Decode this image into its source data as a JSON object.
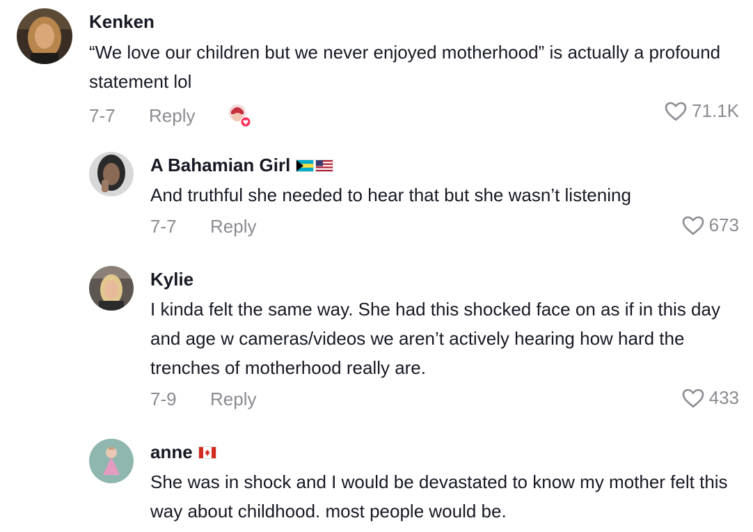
{
  "comments": [
    {
      "username": "Kenken",
      "text": "“We love our children but we never enjoyed motherhood” is actually a profound statement lol",
      "date": "7-7",
      "reply_label": "Reply",
      "likes": "71.1K",
      "creator_liked": true
    },
    {
      "username": "A Bahamian Girl",
      "flags": [
        "bahamas-flag",
        "usa-flag"
      ],
      "text": "And truthful she needed to hear that but she wasn’t listening",
      "date": "7-7",
      "reply_label": "Reply",
      "likes": "673"
    },
    {
      "username": "Kylie",
      "text": "I kinda felt the same way. She had this shocked face on as if in this day and age w cameras/videos we aren’t actively hearing how hard the trenches of motherhood really are.",
      "date": "7-9",
      "reply_label": "Reply",
      "likes": "433"
    },
    {
      "username": "anne",
      "flags": [
        "canada-flag"
      ],
      "text": "She was in shock and I would be devastated to know my mother felt this way about childhood. most people would be."
    }
  ],
  "colors": {
    "text": "#161823",
    "secondary": "#8a8b91",
    "liked_red": "#fe2c55"
  }
}
